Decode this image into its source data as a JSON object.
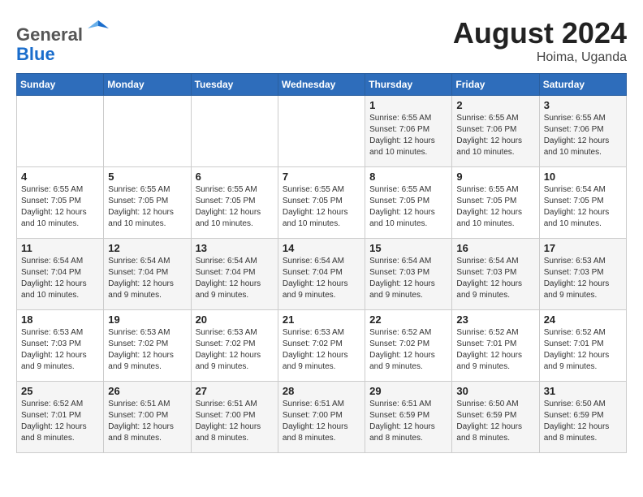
{
  "header": {
    "logo_line1": "General",
    "logo_line2": "Blue",
    "month_year": "August 2024",
    "location": "Hoima, Uganda"
  },
  "weekdays": [
    "Sunday",
    "Monday",
    "Tuesday",
    "Wednesday",
    "Thursday",
    "Friday",
    "Saturday"
  ],
  "weeks": [
    [
      {
        "day": "",
        "info": ""
      },
      {
        "day": "",
        "info": ""
      },
      {
        "day": "",
        "info": ""
      },
      {
        "day": "",
        "info": ""
      },
      {
        "day": "1",
        "info": "Sunrise: 6:55 AM\nSunset: 7:06 PM\nDaylight: 12 hours\nand 10 minutes."
      },
      {
        "day": "2",
        "info": "Sunrise: 6:55 AM\nSunset: 7:06 PM\nDaylight: 12 hours\nand 10 minutes."
      },
      {
        "day": "3",
        "info": "Sunrise: 6:55 AM\nSunset: 7:06 PM\nDaylight: 12 hours\nand 10 minutes."
      }
    ],
    [
      {
        "day": "4",
        "info": "Sunrise: 6:55 AM\nSunset: 7:05 PM\nDaylight: 12 hours\nand 10 minutes."
      },
      {
        "day": "5",
        "info": "Sunrise: 6:55 AM\nSunset: 7:05 PM\nDaylight: 12 hours\nand 10 minutes."
      },
      {
        "day": "6",
        "info": "Sunrise: 6:55 AM\nSunset: 7:05 PM\nDaylight: 12 hours\nand 10 minutes."
      },
      {
        "day": "7",
        "info": "Sunrise: 6:55 AM\nSunset: 7:05 PM\nDaylight: 12 hours\nand 10 minutes."
      },
      {
        "day": "8",
        "info": "Sunrise: 6:55 AM\nSunset: 7:05 PM\nDaylight: 12 hours\nand 10 minutes."
      },
      {
        "day": "9",
        "info": "Sunrise: 6:55 AM\nSunset: 7:05 PM\nDaylight: 12 hours\nand 10 minutes."
      },
      {
        "day": "10",
        "info": "Sunrise: 6:54 AM\nSunset: 7:05 PM\nDaylight: 12 hours\nand 10 minutes."
      }
    ],
    [
      {
        "day": "11",
        "info": "Sunrise: 6:54 AM\nSunset: 7:04 PM\nDaylight: 12 hours\nand 10 minutes."
      },
      {
        "day": "12",
        "info": "Sunrise: 6:54 AM\nSunset: 7:04 PM\nDaylight: 12 hours\nand 9 minutes."
      },
      {
        "day": "13",
        "info": "Sunrise: 6:54 AM\nSunset: 7:04 PM\nDaylight: 12 hours\nand 9 minutes."
      },
      {
        "day": "14",
        "info": "Sunrise: 6:54 AM\nSunset: 7:04 PM\nDaylight: 12 hours\nand 9 minutes."
      },
      {
        "day": "15",
        "info": "Sunrise: 6:54 AM\nSunset: 7:03 PM\nDaylight: 12 hours\nand 9 minutes."
      },
      {
        "day": "16",
        "info": "Sunrise: 6:54 AM\nSunset: 7:03 PM\nDaylight: 12 hours\nand 9 minutes."
      },
      {
        "day": "17",
        "info": "Sunrise: 6:53 AM\nSunset: 7:03 PM\nDaylight: 12 hours\nand 9 minutes."
      }
    ],
    [
      {
        "day": "18",
        "info": "Sunrise: 6:53 AM\nSunset: 7:03 PM\nDaylight: 12 hours\nand 9 minutes."
      },
      {
        "day": "19",
        "info": "Sunrise: 6:53 AM\nSunset: 7:02 PM\nDaylight: 12 hours\nand 9 minutes."
      },
      {
        "day": "20",
        "info": "Sunrise: 6:53 AM\nSunset: 7:02 PM\nDaylight: 12 hours\nand 9 minutes."
      },
      {
        "day": "21",
        "info": "Sunrise: 6:53 AM\nSunset: 7:02 PM\nDaylight: 12 hours\nand 9 minutes."
      },
      {
        "day": "22",
        "info": "Sunrise: 6:52 AM\nSunset: 7:02 PM\nDaylight: 12 hours\nand 9 minutes."
      },
      {
        "day": "23",
        "info": "Sunrise: 6:52 AM\nSunset: 7:01 PM\nDaylight: 12 hours\nand 9 minutes."
      },
      {
        "day": "24",
        "info": "Sunrise: 6:52 AM\nSunset: 7:01 PM\nDaylight: 12 hours\nand 9 minutes."
      }
    ],
    [
      {
        "day": "25",
        "info": "Sunrise: 6:52 AM\nSunset: 7:01 PM\nDaylight: 12 hours\nand 8 minutes."
      },
      {
        "day": "26",
        "info": "Sunrise: 6:51 AM\nSunset: 7:00 PM\nDaylight: 12 hours\nand 8 minutes."
      },
      {
        "day": "27",
        "info": "Sunrise: 6:51 AM\nSunset: 7:00 PM\nDaylight: 12 hours\nand 8 minutes."
      },
      {
        "day": "28",
        "info": "Sunrise: 6:51 AM\nSunset: 7:00 PM\nDaylight: 12 hours\nand 8 minutes."
      },
      {
        "day": "29",
        "info": "Sunrise: 6:51 AM\nSunset: 6:59 PM\nDaylight: 12 hours\nand 8 minutes."
      },
      {
        "day": "30",
        "info": "Sunrise: 6:50 AM\nSunset: 6:59 PM\nDaylight: 12 hours\nand 8 minutes."
      },
      {
        "day": "31",
        "info": "Sunrise: 6:50 AM\nSunset: 6:59 PM\nDaylight: 12 hours\nand 8 minutes."
      }
    ]
  ]
}
